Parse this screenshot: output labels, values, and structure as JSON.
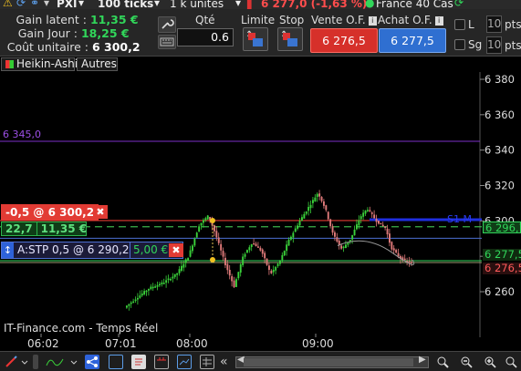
{
  "topbar": {
    "instrument": "PXI",
    "ticks": "100 ticks",
    "units": "1 k unités",
    "price_change": "6 277,0 (-1,63 %)",
    "market": "France 40 Cas"
  },
  "gains": {
    "latent_label": "Gain latent :",
    "latent_value": "11,35 €",
    "jour_label": "Gain Jour :",
    "jour_value": "18,25 €",
    "cout_label": "Coût unitaire :",
    "cout_value": "6 300,2"
  },
  "order": {
    "qty_label": "Qté",
    "qty_value": "0.6",
    "limit_label": "Limite",
    "stop_label": "Stop",
    "sell_header": "Vente O.F.",
    "buy_header": "Achat O.F.",
    "sell_price": "6 276,5",
    "buy_price": "6 277,5",
    "l_label": "L",
    "sg_label": "Sg",
    "pts_value_1": "10",
    "pts_value_2": "10",
    "pts_label": "pts"
  },
  "tabs": [
    "Heikin-Ashi",
    "Autres"
  ],
  "chart_data": {
    "type": "candlestick",
    "style": "Heikin-Ashi",
    "y_ticks": [
      6380,
      6360,
      6340,
      6320,
      6300,
      6280,
      6260
    ],
    "y_tick_labels": [
      "6 380",
      "6 360",
      "6 340",
      "6 320",
      "6 300",
      "6 280",
      "6 260"
    ],
    "x_tick_labels": [
      "06:02",
      "07:01",
      "08:00",
      "09:00"
    ],
    "level_6345_label": "6 345,0",
    "level_6345": 6345,
    "s1_label": "S1 M",
    "position_line": 6300.2,
    "dashed_line": 6296.7,
    "stop_line": 6290.2,
    "bid_line": 6276.5,
    "ask_line": 6277.5,
    "colors": {
      "up": "#3ad13a",
      "down": "#e07a7a",
      "level_6345": "#7b2fc6",
      "s1": "#1f2fe0",
      "position": "#e23b34",
      "dashed": "#3cb34a"
    }
  },
  "price_tags": {
    "dashed": "6 296,7",
    "ask": "6 277,5",
    "bid": "6 276,5"
  },
  "overlays": {
    "position_label": "-0,5 @ 6 300,2",
    "position_gain_pts": "22,7",
    "position_gain_eur": "11,35 €",
    "stop_label": "A:STP  0,5 @ 6 290,2",
    "stop_gain": "5,00 €",
    "close_glyph": "✖",
    "watermark": "IT-Finance.com - Temps Réel"
  }
}
